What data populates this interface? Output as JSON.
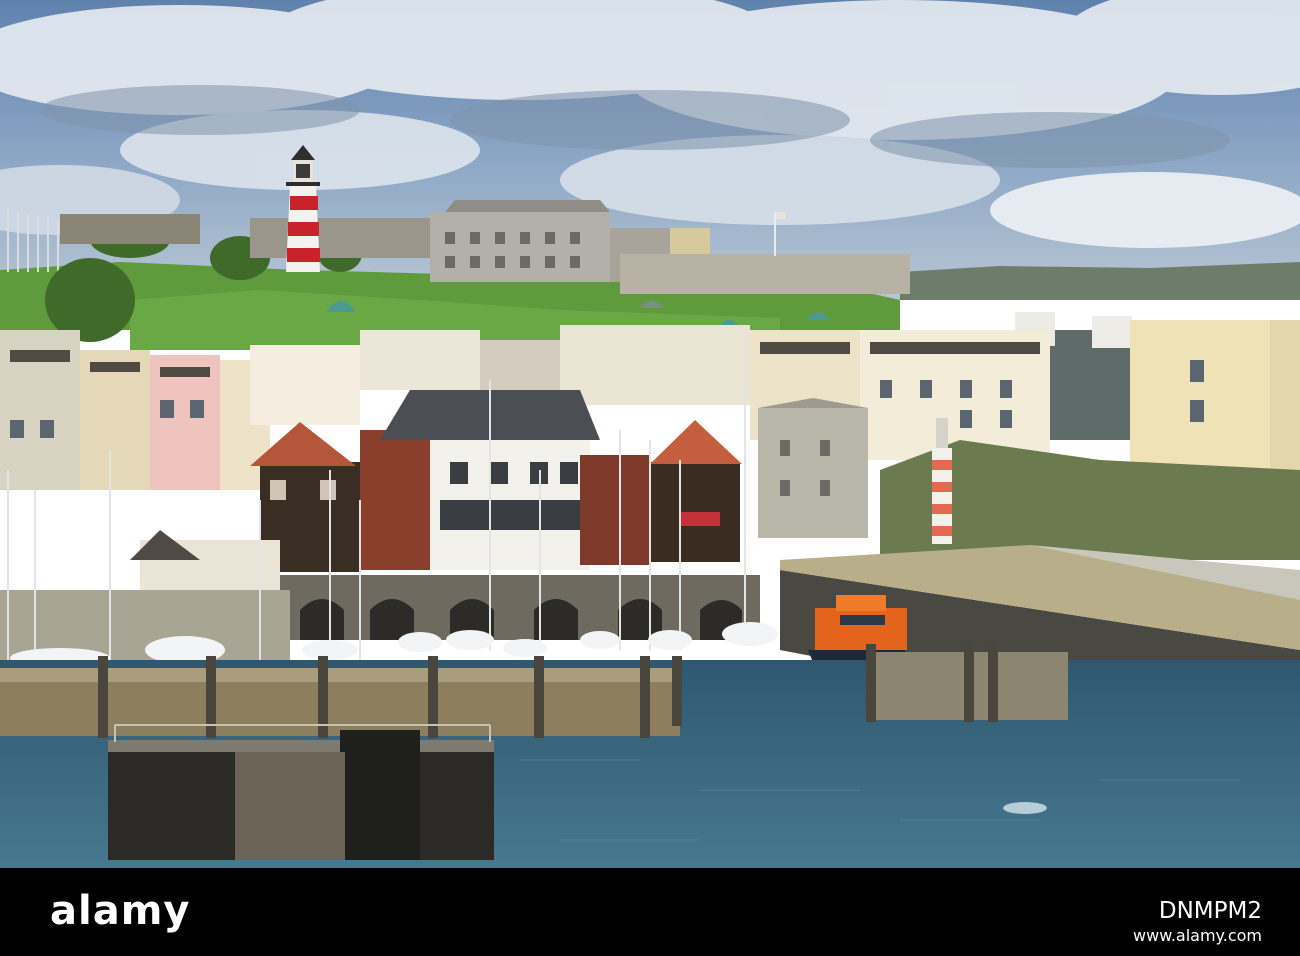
{
  "photo": {
    "subject": "harbour-town-with-lighthouse-and-marina",
    "colors": {
      "sky_top": "#6f8fb5",
      "cloud": "#e6ecf2",
      "grass": "#5f9a3c",
      "water": "#3f6e8a",
      "lighthouse_red": "#c8222a",
      "lifeboat_orange": "#e4641e",
      "roof_terracotta": "#b5553a",
      "stone": "#b9b6aa"
    }
  },
  "watermark": {
    "logo_text_a": "alamy",
    "logo_text_b": "",
    "image_code": "DNMPM2",
    "url": "www.alamy.com",
    "background": "#000000",
    "text_color": "#ffffff"
  }
}
